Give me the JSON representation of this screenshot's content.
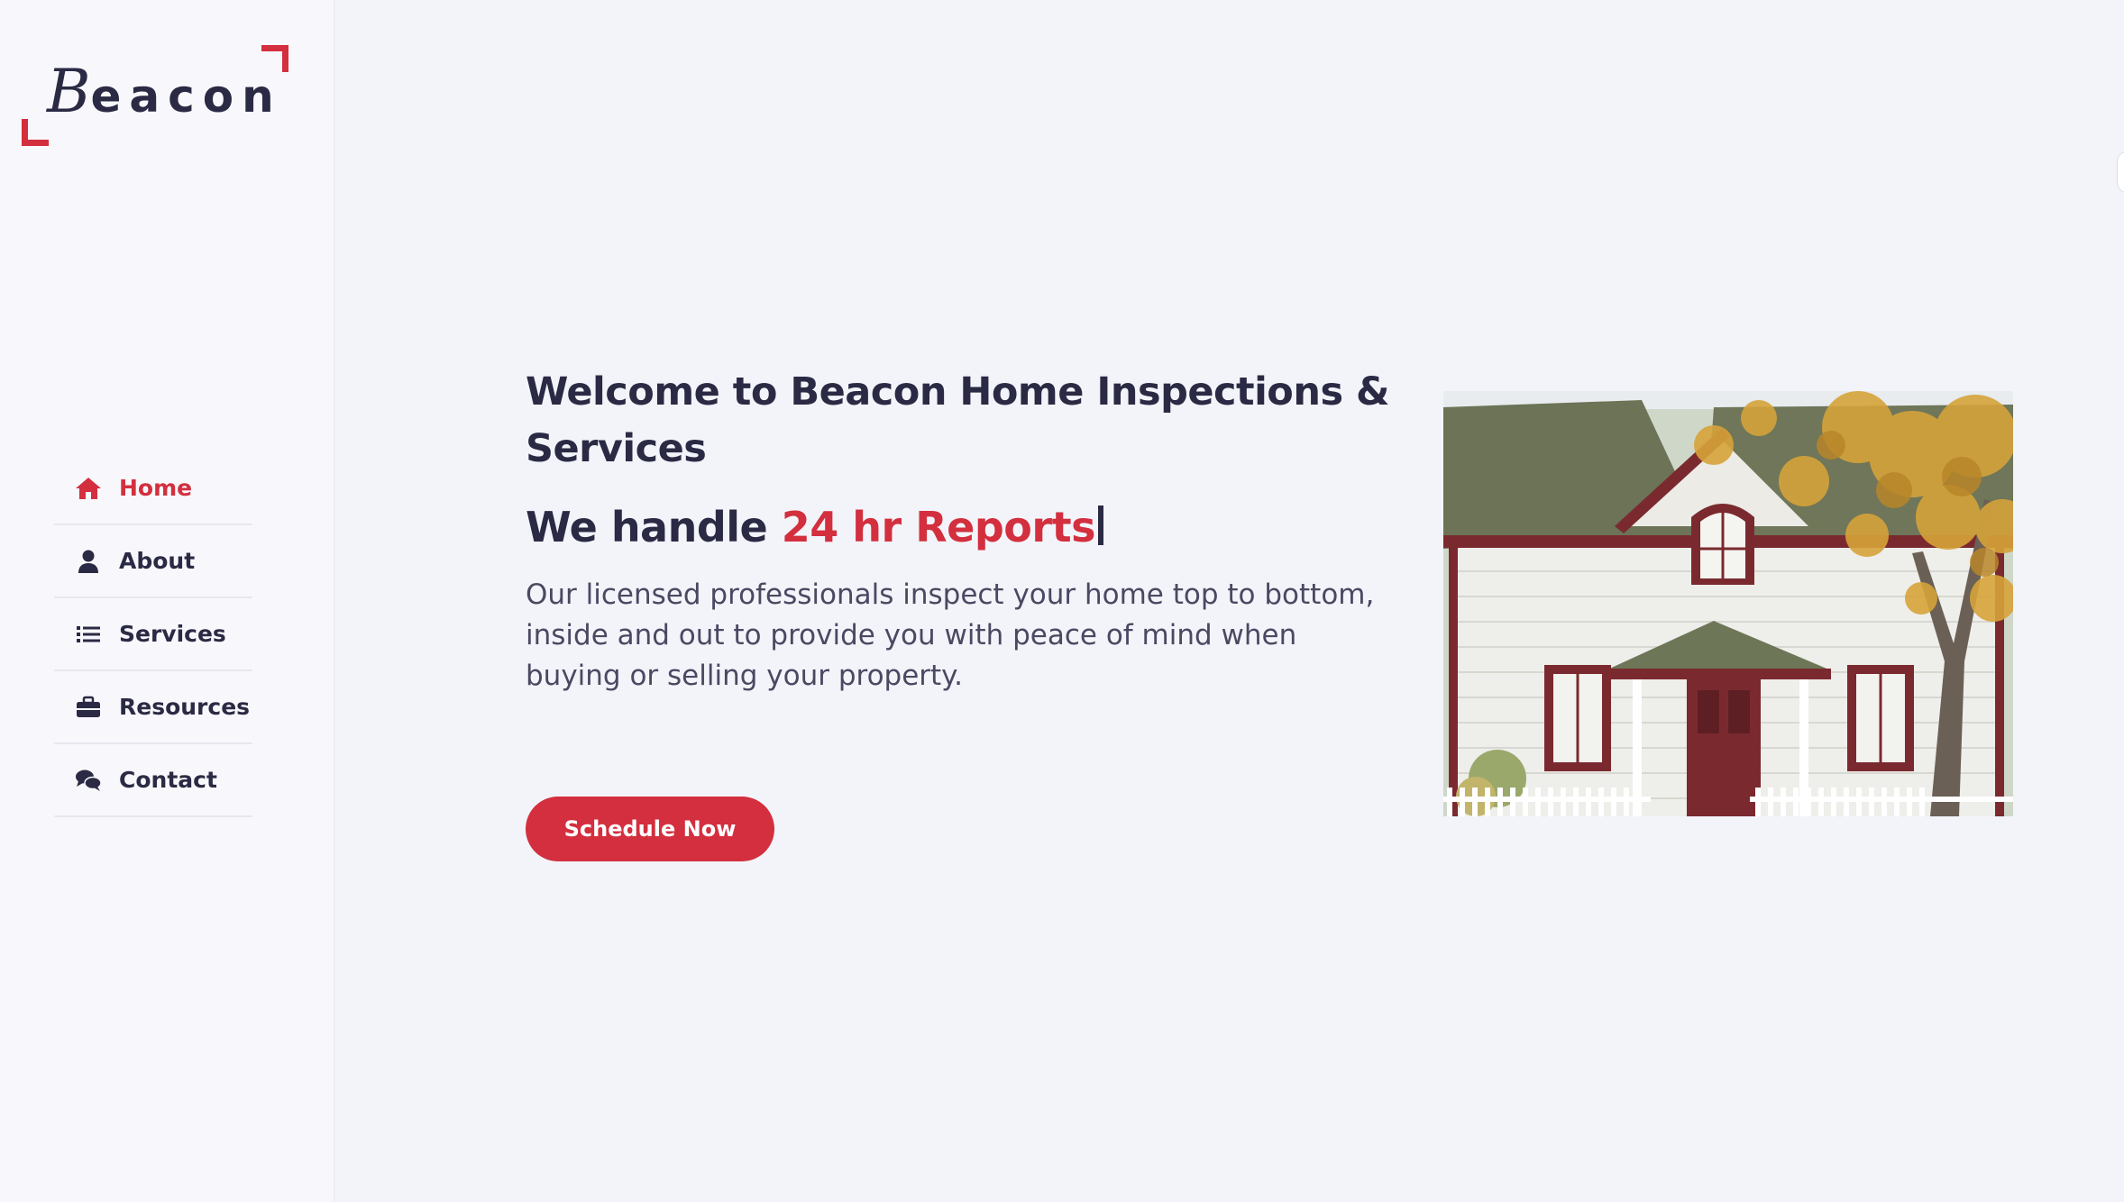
{
  "brand": {
    "logo_initial": "B",
    "logo_rest": "eacon",
    "accent_color": "#d32f3e",
    "text_color": "#2b2a44"
  },
  "nav": {
    "items": [
      {
        "label": "Home",
        "icon": "home-icon",
        "active": true
      },
      {
        "label": "About",
        "icon": "user-icon",
        "active": false
      },
      {
        "label": "Services",
        "icon": "list-icon",
        "active": false
      },
      {
        "label": "Resources",
        "icon": "briefcase-icon",
        "active": false
      },
      {
        "label": "Contact",
        "icon": "chat-bubbles-icon",
        "active": false
      }
    ]
  },
  "hero": {
    "headline": "Welcome to Beacon Home Inspections & Services",
    "tagline_prefix": "We handle ",
    "tagline_highlight": "24 hr Reports",
    "description": "Our licensed professionals inspect your home top to bottom, inside and out to provide you with peace of mind when buying or selling your property.",
    "cta_label": "Schedule Now",
    "image_alt": "white house with red trim and autumn tree"
  }
}
